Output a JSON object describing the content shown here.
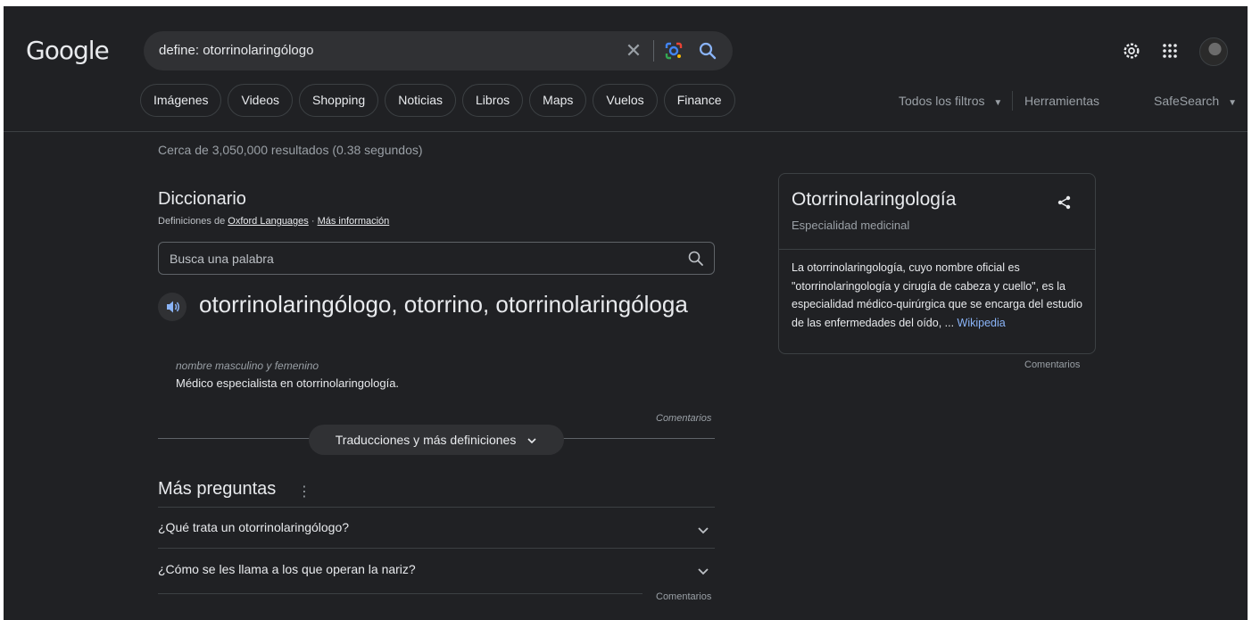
{
  "header": {
    "logo": "Google",
    "search_query": "define: otorrinolaringólogo",
    "clear_symbol": "✕"
  },
  "chips": [
    "Imágenes",
    "Videos",
    "Shopping",
    "Noticias",
    "Libros",
    "Maps",
    "Vuelos",
    "Finance"
  ],
  "filters": {
    "all_filters": "Todos los filtros",
    "tools": "Herramientas",
    "safesearch": "SafeSearch"
  },
  "stats": "Cerca de 3,050,000 resultados (0.38 segundos)",
  "dictionary": {
    "title": "Diccionario",
    "source_prefix": "Definiciones de",
    "source_link": "Oxford Languages",
    "separator": " · ",
    "more_info": "Más información",
    "search_placeholder": "Busca una palabra",
    "headword": "otorrinolaringólogo, otorrino, otorrinolaringóloga",
    "part_of_speech": "nombre masculino y femenino",
    "definition": "Médico especialista en otorrinolaringología.",
    "feedback": "Comentarios",
    "translations_button": "Traducciones y más definiciones"
  },
  "more_questions": {
    "title": "Más preguntas",
    "more_symbol": "⋮",
    "questions": [
      "¿Qué trata un otorrinolaringólogo?",
      "¿Cómo se les llama a los que operan la nariz?"
    ],
    "feedback": "Comentarios"
  },
  "knowledge_panel": {
    "title": "Otorrinolaringología",
    "subtitle": "Especialidad medicinal",
    "description": "La otorrinolaringología, cuyo nombre oficial es \"otorrinolaringología y cirugía de cabeza y cuello\", es la especialidad médico-quirúrgica que se encarga del estudio de las enfermedades del oído, ... ",
    "source_link": "Wikipedia",
    "feedback": "Comentarios"
  },
  "colors": {
    "background": "#202124",
    "link_blue": "#8ab4f8",
    "text_primary": "#e8eaed",
    "text_secondary": "#9aa0a6"
  }
}
